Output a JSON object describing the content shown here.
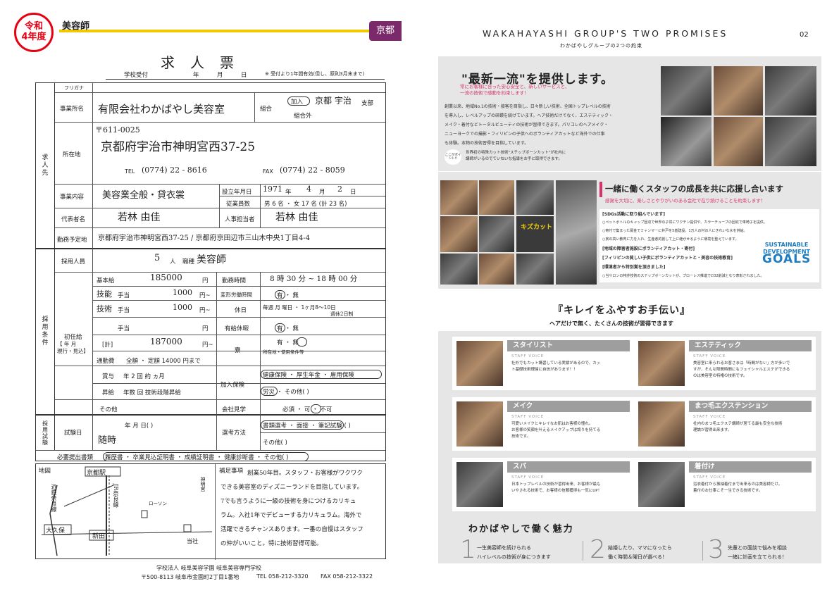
{
  "left": {
    "badge": "令和\n4年度",
    "job_title": "美容師",
    "region": "京都",
    "form_title": "求人票",
    "reception": {
      "label": "学校受付",
      "year": "年",
      "month": "月",
      "day": "日",
      "note": "※ 受付より1年間有効(但し、原則3月末まで)"
    },
    "s1": {
      "side": "求\n人\n先",
      "furigana_label": "フリガナ",
      "company_label": "事業所名",
      "company": "有限会社わかばやし美容室",
      "union_label": "組合",
      "union_in": "加入",
      "union_branch": "京都 宇治",
      "branch_label": "支部",
      "union_out": "組合外",
      "address_label": "所在地",
      "postal": "〒611-0025",
      "address": "京都府宇治市神明宮西37-25",
      "tel_label": "TEL",
      "tel": "(0774) 22 - 8616",
      "fax_label": "FAX",
      "fax": "(0774) 22 - 8059",
      "business_label": "事業内容",
      "business": "美容業全般・貸衣裳",
      "founded_label": "設立年月日",
      "founded_y": "1971",
      "year_u": "年",
      "founded_m": "4",
      "month_u": "月",
      "founded_d": "2",
      "day_u": "日",
      "employees_label": "従業員数",
      "emp_text": "男 6 名 ・ 女 17 名 (計 23 名)",
      "rep_label": "代表者名",
      "rep": "若林 由佳",
      "hr_label": "人事担当者",
      "hr": "若林 由佳",
      "workplace_label": "勤務予定地",
      "workplace": "京都府宇治市神明宮西37-25 / 京都府京田辺市三山木中央1丁目4-4"
    },
    "s2": {
      "side": "採\n用\n条\n件",
      "hires_label": "採用人員",
      "hires": "5",
      "hires_unit": "人",
      "role_label": "職種",
      "role": "美容師",
      "base_label": "基本給",
      "base": "185000",
      "yen": "円",
      "hours_label": "勤務時間",
      "hours": "8 時 30 分 ~ 18 時 00 分",
      "a1": "技能",
      "a1_label": "手当",
      "a1_val": "1000",
      "a1_unit": "円~",
      "flex_label": "変形労働時間",
      "flex": "有 ・ 無",
      "a2": "技術",
      "a2_label": "手当",
      "a2_val": "1000",
      "a2_unit": "円~",
      "holiday_label": "休日",
      "holiday": "毎週 月 曜日 ・ 1ヶ月8～10日",
      "holiday_note": "週休2日制",
      "a3_label": "手当",
      "a3_unit": "円",
      "paid_label": "有給休暇",
      "paid": "有 ・ 無",
      "initial_label": "初任給",
      "initial_sub": "【 年 月\n現行・見込】",
      "total_label": "[計]",
      "total": "187000",
      "total_unit": "円~",
      "dorm_label": "寮",
      "dorm": "有 ・ 無",
      "dorm_note": "所在地・使用条件等",
      "commute_label": "通勤費",
      "commute": "全額 ・ 定額 14000 円まで",
      "raise_label": "賞与",
      "raise": "年 2 回   約   ヵ月",
      "promo_label": "昇給",
      "promo": "年数 回  技術段階昇給",
      "ins_label": "加入保険",
      "ins1": "健康保険 ・ 厚生年金 ・ 雇用保険",
      "ins2": "労災 ・ その他(          )",
      "other_label": "その他",
      "visit_label": "会社見学",
      "visit": "必須 ・ 可 ・ 不可"
    },
    "s3": {
      "side": "採\n用\n試\n験",
      "date_label": "試験日",
      "date_row": "年   月   日(   )",
      "date_hw": "随時",
      "method_label": "選考方法",
      "method": "書類選考 ・ 面接 ・ 筆記試験 (         )",
      "method2": "その他(             )",
      "docs_label": "必要提出書類",
      "docs": "履歴書 ・ 卒業見込証明書 ・ 成績証明書 ・ 健康診断書 ・ その他(        )"
    },
    "s4": {
      "map_label": "地図",
      "map": [
        "京都駅",
        "近鉄奈良線",
        "JR奈良線",
        "ローソン",
        "神明宮",
        "大久保",
        "新田",
        "当社"
      ],
      "notes_label": "補足事項",
      "notes": [
        "創業50年目。スタッフ・お客様がワクワク",
        "できる美容室のディズニーランドを目指しています。",
        "7でも言うように一級の技術を身につけるカリキュ",
        "ラム。入社1年でデビューする力リキュラム。海外で",
        "活躍できるチャンスあります。一番の自慢はスタッフ",
        "の仲がいいこと。特に技術習得可能。"
      ]
    },
    "footer": {
      "school": "学校法人 岐阜美容学園 岐阜美容専門学校",
      "address": "〒500-8113 岐阜市金園町2丁目1番地",
      "tel": "TEL 058-212-3320",
      "fax": "FAX 058-212-3322"
    }
  },
  "right": {
    "title": "WAKAHAYASHI GROUP'S TWO PROMISES",
    "subtitle": "わかばやしグループの2つの約束",
    "page": "02",
    "p1": {
      "heading": "\"最新一流\"を提供します。",
      "pink": [
        "常にお客様に合った安心安全と、新しいサービスと、",
        "一流の技術で感動を約束します！"
      ],
      "body": [
        "創業以来、地域No.1の技術・接客を目指し、日々新しい技術、全国トップレベルの技術",
        "を導入し、レベルアップの研鑽を続けています。ヘア技術だけでなく、エステティック・",
        "メイク・着付などトータルビューティの技術が習得できます。パリコレのヘアメイク・",
        "ニューヨークでの撮影・フィリピンの子供へのボランティアカットなど海外での仕事",
        "も体験。本物の技術習得を目指しています。"
      ],
      "point_icon": "ここがポイント!!",
      "point": [
        "世界初の特殊カット技術\"スチップボーンカット\"が社内に",
        "講師がいるのでていねいな指導をお手に取得できます。"
      ]
    },
    "p2": {
      "heading": "一緒に働くスタッフの成長を共に応援し合います",
      "pink": "感謝を大切に、楽しさとやりがいのある会社で在り続けることを約束します！",
      "board": "キズカット",
      "items": [
        "[SDGs活動に取り組んでいます]",
        "○ペットボトルのキャップ回収で世界の子供にワクチン提供や、カラーチューブの回収で車椅子を提供。",
        "○寄付で集まった募金でミャンマーに井戸を5基建設。1万人の村の人にきれいな水を供給。",
        "○貧の高い教育に力を入れ、生産者的創して上に継がせるように環境を整えています。",
        "[地域の障害者施設にボランティアカット・寄付]",
        "[フィリピンの貧しい子供にボランティアカットと・美容の技術教育]",
        "[環境者から特別賞を頂きました]",
        "○当サロンの特許技術のステップボーンカットが、プローレス推進でCO2削減となり表彰されました。"
      ],
      "sdg_lines": [
        "SUSTAINABLE",
        "DEVELOPMENT",
        "GOALS"
      ]
    },
    "kirei": {
      "title": "『キレイをふやすお手伝い』",
      "sub": "ヘアだけで無く、たくさんの技術が習得できます"
    },
    "cards": [
      {
        "name": "スタイリスト",
        "sv": "STAFF VOICE",
        "text": [
          "社外でもカット講習している実績があるので、カッ",
          "ト基礎技術理論に自信があります！！"
        ]
      },
      {
        "name": "エステティック",
        "sv": "STAFF VOICE",
        "text": [
          "美容室に来られるお客さまは「時間がない」方が多いで",
          "すが、そんな隙間時間にもフェイシャルエステができる",
          "のは美容室の特権の技術です。"
        ]
      },
      {
        "name": "メイク",
        "sv": "STAFF VOICE",
        "text": [
          "可愛いメイクとキレイなお肌はお客様の憧れ。",
          "お客様の笑顔を叶えるメイクアップは誇りを持てる",
          "技術です。"
        ]
      },
      {
        "name": "まつ毛エクステンション",
        "sv": "STAFF VOICE",
        "text": [
          "社内のまつ毛エクステ講師が居てる最も安全な技術",
          "理論が習得出来ます。"
        ]
      },
      {
        "name": "スパ",
        "sv": "STAFF VOICE",
        "text": [
          "日本トップレベルの技術が習得出来、お客様が最も",
          "いやされる技術で、お客様の信頼獲得も一気にUP！"
        ]
      },
      {
        "name": "着付け",
        "sv": "STAFF VOICE",
        "text": [
          "浴衣着付から振袖着付まで出来るのは美容師だけ。",
          "着付のお仕事こそ一生できる技術です。"
        ]
      }
    ],
    "charm": {
      "title": "わかばやしで働く魅力",
      "items": [
        {
          "num": "1",
          "lines": [
            "一生美容師を続けられる",
            "ハイレベルの技術が身につきます"
          ]
        },
        {
          "num": "2",
          "lines": [
            "結婚したり、ママになったら",
            "働く時間＆曜日が選べる！"
          ]
        },
        {
          "num": "3",
          "lines": [
            "先輩との面談で悩みを相談",
            "一緒に計画を立てられる！"
          ]
        }
      ]
    }
  }
}
